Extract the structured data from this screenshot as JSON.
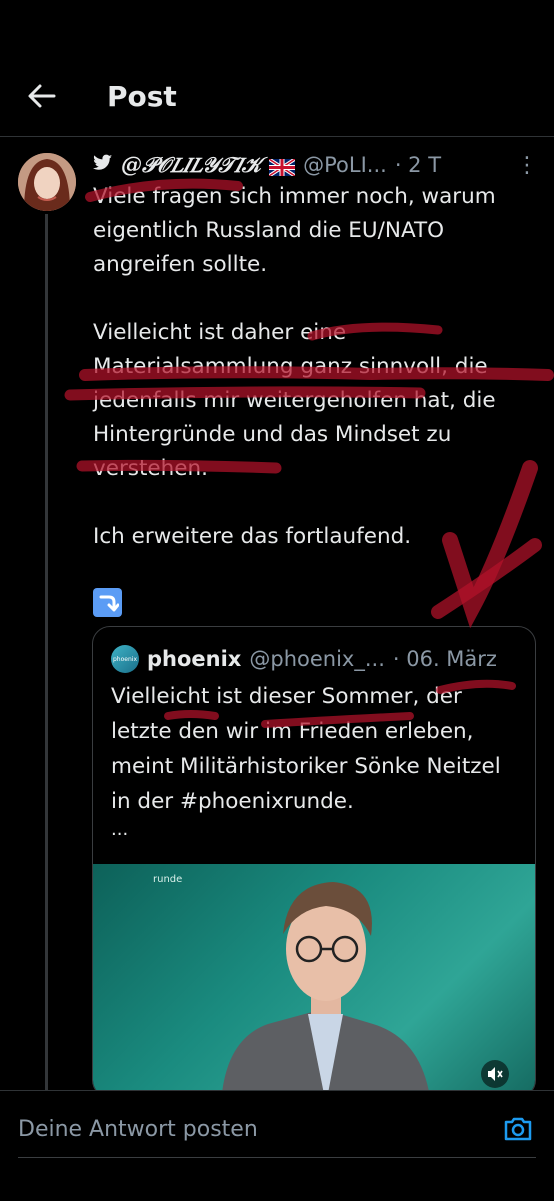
{
  "header": {
    "title": "Post"
  },
  "tweet": {
    "display_name": "@𝒫𝒪𝐿𝐼𝐿𝒴𝒯𝐼𝒦",
    "handle": "@PoLI...",
    "time": "· 2 T",
    "paragraphs": [
      "Viele fragen sich immer noch, warum eigentlich Russland die EU/NATO angreifen sollte.",
      "Vielleicht ist daher eine Materialsammlung ganz sinnvoll, die jedenfalls mir weitergeholfen hat, die Hintergründe und das Mindset zu verstehen.",
      "Ich erweitere das fortlaufend."
    ],
    "emoji_icon": "arrow-right-curving-down-icon"
  },
  "quote": {
    "logo_text": "phoenix",
    "name": "phoenix",
    "handle": "@phoenix_...",
    "date": "· 06. März",
    "text": "Vielleicht ist dieser Sommer, der letzte den wir im Frieden erleben, meint Militärhistoriker Sönke Neitzel in der #phoenixrunde.",
    "more": "...",
    "video_label": "runde"
  },
  "reply": {
    "placeholder": "Deine Antwort posten"
  },
  "colors": {
    "background": "#000000",
    "text": "#e7e9ea",
    "muted": "#8b98a5",
    "accent": "#1d9bf0",
    "annotation": "#b3122a"
  }
}
